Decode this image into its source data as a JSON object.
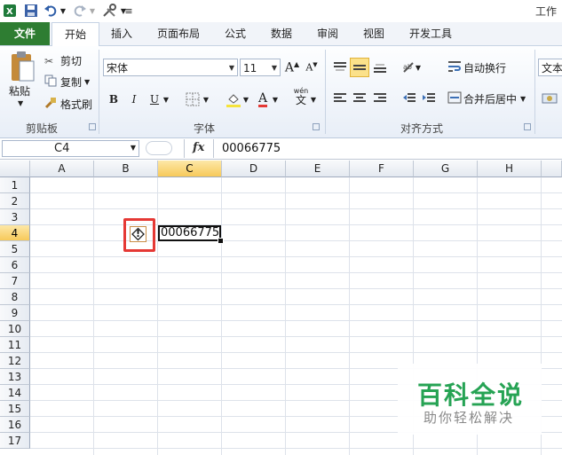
{
  "window": {
    "title_partial": "工作"
  },
  "tabs": [
    "文件",
    "开始",
    "插入",
    "页面布局",
    "公式",
    "数据",
    "审阅",
    "视图",
    "开发工具"
  ],
  "clipboard": {
    "paste": "粘贴",
    "cut": "剪切",
    "copy": "复制",
    "format_painter": "格式刷",
    "group": "剪贴板"
  },
  "font": {
    "name": "宋体",
    "size": "11",
    "bold": "B",
    "italic": "I",
    "underline": "U",
    "font_color_glyph": "A",
    "wen": "wén",
    "wen_char": "文",
    "group": "字体"
  },
  "alignment": {
    "wrap": "自动换行",
    "merge": "合并后居中",
    "group": "对齐方式"
  },
  "number": {
    "format_partial": "文本"
  },
  "formula_bar": {
    "cell_ref": "C4",
    "fx": "fx",
    "value": "00066775"
  },
  "columns": [
    "A",
    "B",
    "C",
    "D",
    "E",
    "F",
    "G",
    "H"
  ],
  "rows": [
    "1",
    "2",
    "3",
    "4",
    "5",
    "6",
    "7",
    "8",
    "9",
    "10",
    "11",
    "12",
    "13",
    "14",
    "15",
    "16",
    "17"
  ],
  "selected": {
    "column": "C",
    "row": "4"
  },
  "cell_c4": "00066775",
  "error_icon_glyph": "!",
  "watermark": {
    "title": "百科全说",
    "subtitle": "助你轻松解决"
  },
  "colors": {
    "accent": "#2e7d32",
    "selection": "#f7c95a",
    "error_border": "#e53935",
    "watermark": "#26a354"
  }
}
